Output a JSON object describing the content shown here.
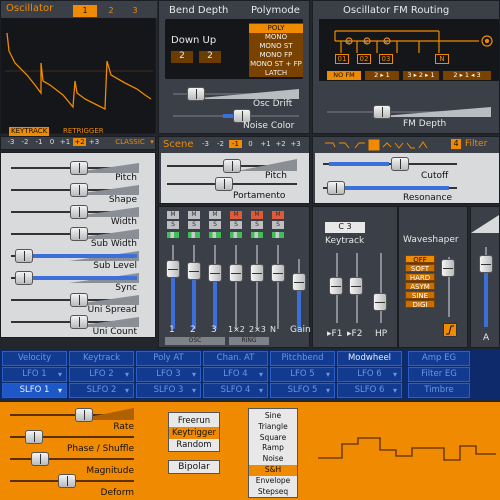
{
  "colors": {
    "accent": "#f08a00",
    "blue": "#3c6fd8",
    "panel": "#3b4048",
    "dark": "#141619",
    "light": "#d9dadc"
  },
  "oscillator": {
    "title": "Oscillator",
    "tabs": [
      "1",
      "2",
      "3"
    ],
    "selected_tab": "1",
    "keytrack": "KEYTRACK",
    "retrigger": "RETRIGGER",
    "octave_buttons": [
      "-3",
      "-2",
      "-1",
      "0",
      "+1",
      "+2",
      "+3"
    ],
    "selected_octave": "+2",
    "mode": "CLASSIC",
    "params": [
      {
        "label": "Pitch",
        "value": 0.5
      },
      {
        "label": "Shape",
        "value": 0.5
      },
      {
        "label": "Width",
        "value": 0.5
      },
      {
        "label": "Sub Width",
        "value": 0.5
      },
      {
        "label": "Sub Level",
        "value": 0.0
      },
      {
        "label": "Sync",
        "value": 0.0
      },
      {
        "label": "Uni Spread",
        "value": 0.5
      },
      {
        "label": "Uni Count",
        "value": 0.5
      }
    ]
  },
  "bend": {
    "title": "Bend Depth",
    "down_up": "Down Up",
    "down": "2",
    "up": "2"
  },
  "polymode": {
    "title": "Polymode",
    "items": [
      "POLY",
      "MONO",
      "MONO ST",
      "MONO FP",
      "MONO ST + FP",
      "LATCH"
    ],
    "selected": "POLY"
  },
  "osc_drift": {
    "label": "Osc Drift",
    "value": 0.15
  },
  "noise_color": {
    "label": "Noise Color",
    "value": 0.35
  },
  "fm": {
    "title": "Oscillator FM Routing",
    "slots": [
      "01",
      "02",
      "03",
      "N"
    ],
    "routes": [
      "NO FM",
      "2 ▸ 1",
      "3 ▸ 2 ▸ 1",
      "2 ▸ 1 ◂ 3"
    ],
    "selected_route": "NO FM",
    "depth_label": "FM Depth",
    "depth_value": 0.3
  },
  "scene": {
    "title": "Scene",
    "octave_buttons": [
      "-3",
      "-2",
      "-1",
      "0",
      "+1",
      "+2",
      "+3"
    ],
    "selected_octave": "-1",
    "pitch_label": "Pitch",
    "portamento_label": "Portamento",
    "pitch_value": 0.5,
    "portamento_value": 0.35
  },
  "mixer": {
    "channels": [
      "1",
      "2",
      "3",
      "1×2",
      "2×3",
      "N"
    ],
    "gain_label": "Gain",
    "group_osc": "OSC",
    "group_ring": "RING",
    "levels": [
      0.25,
      0.15,
      0.05,
      0.05,
      0.05,
      0.05,
      0.05
    ],
    "mute": [
      "M",
      "M",
      "M",
      "M",
      "M",
      "M"
    ],
    "solo": [
      "S",
      "S",
      "S",
      "S",
      "S",
      "S"
    ]
  },
  "filter_strip": {
    "number": "4",
    "title": "Filter",
    "cutoff_label": "Cutoff",
    "resonance_label": "Resonance",
    "cutoff_value": 0.5,
    "resonance_value": 0.1
  },
  "keytrack": {
    "value": "C 3",
    "label": "Keytrack",
    "f1": "F1",
    "f2": "F2",
    "hp": "HP"
  },
  "waveshaper": {
    "title": "Waveshaper",
    "items": [
      "OFF",
      "SOFT",
      "HARD",
      "ASYM",
      "SINE",
      "DIGI"
    ],
    "selected": "OFF"
  },
  "right_strip": {
    "label": "A"
  },
  "mod_tabs": {
    "row1": [
      "Velocity",
      "Keytrack",
      "Poly AT",
      "Chan. AT",
      "Pitchbend",
      "Modwheel",
      "Amp EG"
    ],
    "row2": [
      "LFO 1",
      "LFO 2",
      "LFO 3",
      "LFO 4",
      "LFO 5",
      "LFO 6",
      "Filter EG"
    ],
    "row3": [
      "SLFO 1",
      "SLFO 2",
      "SLFO 3",
      "SLFO 4",
      "SLFO 5",
      "SLFO 6",
      "Timbre"
    ],
    "selected": "SLFO 1"
  },
  "lfo": {
    "params": [
      {
        "label": "Rate",
        "value": 0.55
      },
      {
        "label": "Phase / Shuffle",
        "value": 0.1
      },
      {
        "label": "Magnitude",
        "value": 0.15
      },
      {
        "label": "Deform",
        "value": 0.4
      }
    ],
    "trigger_modes": [
      "Freerun",
      "Keytrigger",
      "Random"
    ],
    "selected_trigger": "Keytrigger",
    "bipolar": "Bipolar",
    "shapes": [
      "Sine",
      "Triangle",
      "Square",
      "Ramp",
      "Noise",
      "S&H",
      "Envelope",
      "Stepseq"
    ],
    "selected_shape": "S&H"
  }
}
